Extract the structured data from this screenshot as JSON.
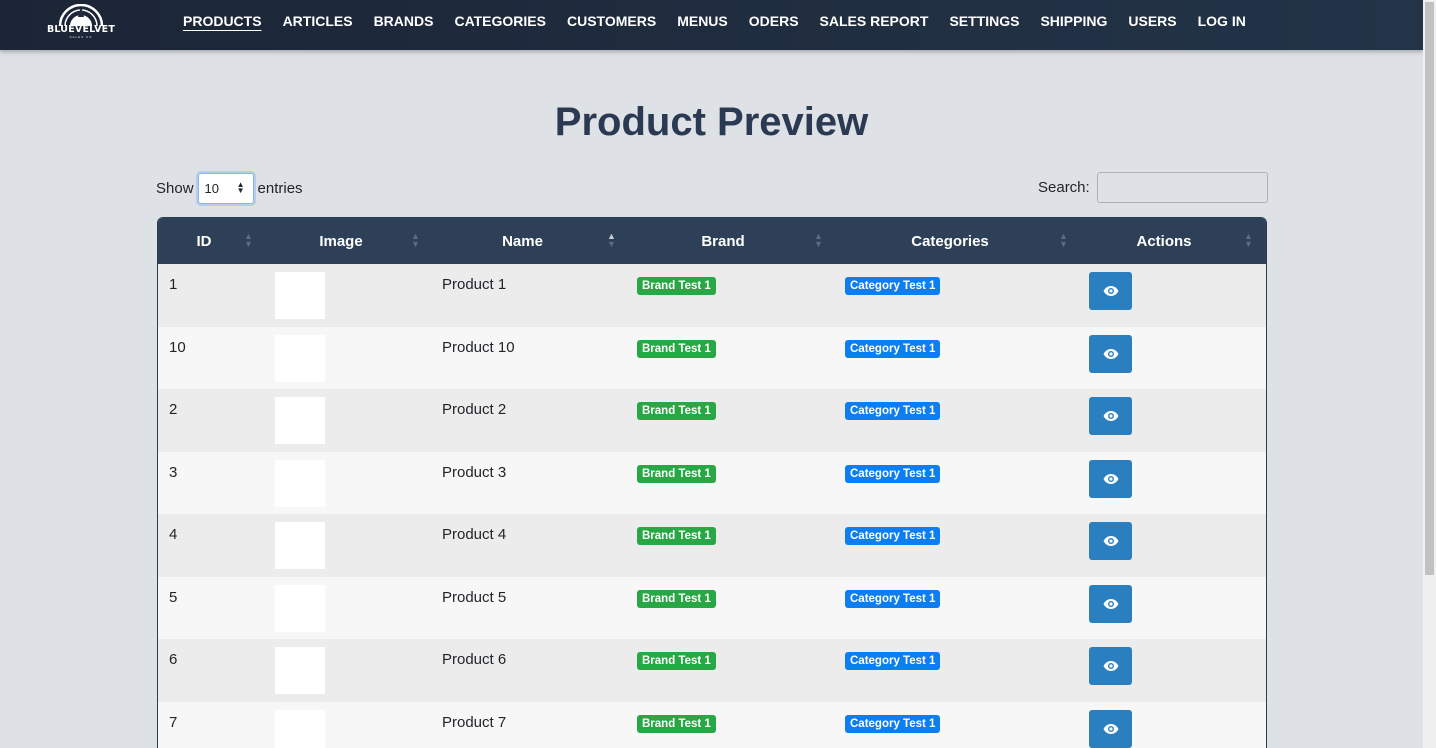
{
  "brand": {
    "name": "BLUEVELVET",
    "subtitle": "SALES CO"
  },
  "nav": {
    "items": [
      {
        "label": "PRODUCTS",
        "active": true
      },
      {
        "label": "ARTICLES"
      },
      {
        "label": "BRANDS"
      },
      {
        "label": "CATEGORIES"
      },
      {
        "label": "CUSTOMERS"
      },
      {
        "label": "MENUS"
      },
      {
        "label": "ODERS"
      },
      {
        "label": "SALES REPORT"
      },
      {
        "label": "SETTINGS"
      },
      {
        "label": "SHIPPING"
      },
      {
        "label": "USERS"
      },
      {
        "label": "LOG IN"
      }
    ]
  },
  "page": {
    "title": "Product Preview"
  },
  "length": {
    "prefix": "Show",
    "value": "10",
    "suffix": "entries"
  },
  "search": {
    "label": "Search:",
    "value": ""
  },
  "table": {
    "columns": [
      "ID",
      "Image",
      "Name",
      "Brand",
      "Categories",
      "Actions"
    ],
    "sorted_column": "Name",
    "rows": [
      {
        "id": "1",
        "name": "Product 1",
        "brand": "Brand Test 1",
        "category": "Category Test 1"
      },
      {
        "id": "10",
        "name": "Product 10",
        "brand": "Brand Test 1",
        "category": "Category Test 1"
      },
      {
        "id": "2",
        "name": "Product 2",
        "brand": "Brand Test 1",
        "category": "Category Test 1"
      },
      {
        "id": "3",
        "name": "Product 3",
        "brand": "Brand Test 1",
        "category": "Category Test 1"
      },
      {
        "id": "4",
        "name": "Product 4",
        "brand": "Brand Test 1",
        "category": "Category Test 1"
      },
      {
        "id": "5",
        "name": "Product 5",
        "brand": "Brand Test 1",
        "category": "Category Test 1"
      },
      {
        "id": "6",
        "name": "Product 6",
        "brand": "Brand Test 1",
        "category": "Category Test 1"
      },
      {
        "id": "7",
        "name": "Product 7",
        "brand": "Brand Test 1",
        "category": "Category Test 1"
      }
    ]
  },
  "colors": {
    "navbar": "#1f2d40",
    "header": "#2e4057",
    "brand_badge": "#28a745",
    "category_badge": "#0d7ef1",
    "view_button": "#2a7fc0"
  }
}
